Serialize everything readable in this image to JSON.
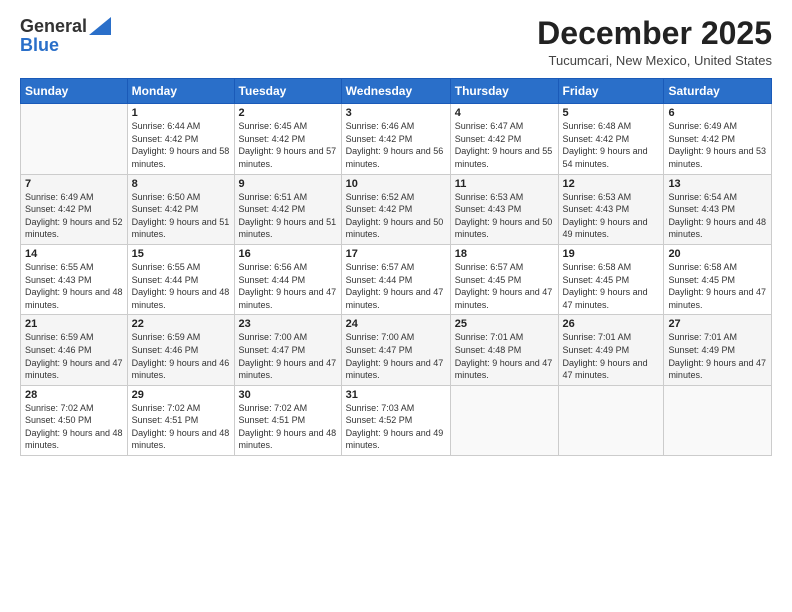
{
  "header": {
    "logo_general": "General",
    "logo_blue": "Blue",
    "month_title": "December 2025",
    "location": "Tucumcari, New Mexico, United States"
  },
  "days_of_week": [
    "Sunday",
    "Monday",
    "Tuesday",
    "Wednesday",
    "Thursday",
    "Friday",
    "Saturday"
  ],
  "weeks": [
    [
      {
        "day": "",
        "sunrise": "",
        "sunset": "",
        "daylight": ""
      },
      {
        "day": "1",
        "sunrise": "Sunrise: 6:44 AM",
        "sunset": "Sunset: 4:42 PM",
        "daylight": "Daylight: 9 hours and 58 minutes."
      },
      {
        "day": "2",
        "sunrise": "Sunrise: 6:45 AM",
        "sunset": "Sunset: 4:42 PM",
        "daylight": "Daylight: 9 hours and 57 minutes."
      },
      {
        "day": "3",
        "sunrise": "Sunrise: 6:46 AM",
        "sunset": "Sunset: 4:42 PM",
        "daylight": "Daylight: 9 hours and 56 minutes."
      },
      {
        "day": "4",
        "sunrise": "Sunrise: 6:47 AM",
        "sunset": "Sunset: 4:42 PM",
        "daylight": "Daylight: 9 hours and 55 minutes."
      },
      {
        "day": "5",
        "sunrise": "Sunrise: 6:48 AM",
        "sunset": "Sunset: 4:42 PM",
        "daylight": "Daylight: 9 hours and 54 minutes."
      },
      {
        "day": "6",
        "sunrise": "Sunrise: 6:49 AM",
        "sunset": "Sunset: 4:42 PM",
        "daylight": "Daylight: 9 hours and 53 minutes."
      }
    ],
    [
      {
        "day": "7",
        "sunrise": "Sunrise: 6:49 AM",
        "sunset": "Sunset: 4:42 PM",
        "daylight": "Daylight: 9 hours and 52 minutes."
      },
      {
        "day": "8",
        "sunrise": "Sunrise: 6:50 AM",
        "sunset": "Sunset: 4:42 PM",
        "daylight": "Daylight: 9 hours and 51 minutes."
      },
      {
        "day": "9",
        "sunrise": "Sunrise: 6:51 AM",
        "sunset": "Sunset: 4:42 PM",
        "daylight": "Daylight: 9 hours and 51 minutes."
      },
      {
        "day": "10",
        "sunrise": "Sunrise: 6:52 AM",
        "sunset": "Sunset: 4:42 PM",
        "daylight": "Daylight: 9 hours and 50 minutes."
      },
      {
        "day": "11",
        "sunrise": "Sunrise: 6:53 AM",
        "sunset": "Sunset: 4:43 PM",
        "daylight": "Daylight: 9 hours and 50 minutes."
      },
      {
        "day": "12",
        "sunrise": "Sunrise: 6:53 AM",
        "sunset": "Sunset: 4:43 PM",
        "daylight": "Daylight: 9 hours and 49 minutes."
      },
      {
        "day": "13",
        "sunrise": "Sunrise: 6:54 AM",
        "sunset": "Sunset: 4:43 PM",
        "daylight": "Daylight: 9 hours and 48 minutes."
      }
    ],
    [
      {
        "day": "14",
        "sunrise": "Sunrise: 6:55 AM",
        "sunset": "Sunset: 4:43 PM",
        "daylight": "Daylight: 9 hours and 48 minutes."
      },
      {
        "day": "15",
        "sunrise": "Sunrise: 6:55 AM",
        "sunset": "Sunset: 4:44 PM",
        "daylight": "Daylight: 9 hours and 48 minutes."
      },
      {
        "day": "16",
        "sunrise": "Sunrise: 6:56 AM",
        "sunset": "Sunset: 4:44 PM",
        "daylight": "Daylight: 9 hours and 47 minutes."
      },
      {
        "day": "17",
        "sunrise": "Sunrise: 6:57 AM",
        "sunset": "Sunset: 4:44 PM",
        "daylight": "Daylight: 9 hours and 47 minutes."
      },
      {
        "day": "18",
        "sunrise": "Sunrise: 6:57 AM",
        "sunset": "Sunset: 4:45 PM",
        "daylight": "Daylight: 9 hours and 47 minutes."
      },
      {
        "day": "19",
        "sunrise": "Sunrise: 6:58 AM",
        "sunset": "Sunset: 4:45 PM",
        "daylight": "Daylight: 9 hours and 47 minutes."
      },
      {
        "day": "20",
        "sunrise": "Sunrise: 6:58 AM",
        "sunset": "Sunset: 4:45 PM",
        "daylight": "Daylight: 9 hours and 47 minutes."
      }
    ],
    [
      {
        "day": "21",
        "sunrise": "Sunrise: 6:59 AM",
        "sunset": "Sunset: 4:46 PM",
        "daylight": "Daylight: 9 hours and 47 minutes."
      },
      {
        "day": "22",
        "sunrise": "Sunrise: 6:59 AM",
        "sunset": "Sunset: 4:46 PM",
        "daylight": "Daylight: 9 hours and 46 minutes."
      },
      {
        "day": "23",
        "sunrise": "Sunrise: 7:00 AM",
        "sunset": "Sunset: 4:47 PM",
        "daylight": "Daylight: 9 hours and 47 minutes."
      },
      {
        "day": "24",
        "sunrise": "Sunrise: 7:00 AM",
        "sunset": "Sunset: 4:47 PM",
        "daylight": "Daylight: 9 hours and 47 minutes."
      },
      {
        "day": "25",
        "sunrise": "Sunrise: 7:01 AM",
        "sunset": "Sunset: 4:48 PM",
        "daylight": "Daylight: 9 hours and 47 minutes."
      },
      {
        "day": "26",
        "sunrise": "Sunrise: 7:01 AM",
        "sunset": "Sunset: 4:49 PM",
        "daylight": "Daylight: 9 hours and 47 minutes."
      },
      {
        "day": "27",
        "sunrise": "Sunrise: 7:01 AM",
        "sunset": "Sunset: 4:49 PM",
        "daylight": "Daylight: 9 hours and 47 minutes."
      }
    ],
    [
      {
        "day": "28",
        "sunrise": "Sunrise: 7:02 AM",
        "sunset": "Sunset: 4:50 PM",
        "daylight": "Daylight: 9 hours and 48 minutes."
      },
      {
        "day": "29",
        "sunrise": "Sunrise: 7:02 AM",
        "sunset": "Sunset: 4:51 PM",
        "daylight": "Daylight: 9 hours and 48 minutes."
      },
      {
        "day": "30",
        "sunrise": "Sunrise: 7:02 AM",
        "sunset": "Sunset: 4:51 PM",
        "daylight": "Daylight: 9 hours and 48 minutes."
      },
      {
        "day": "31",
        "sunrise": "Sunrise: 7:03 AM",
        "sunset": "Sunset: 4:52 PM",
        "daylight": "Daylight: 9 hours and 49 minutes."
      },
      {
        "day": "",
        "sunrise": "",
        "sunset": "",
        "daylight": ""
      },
      {
        "day": "",
        "sunrise": "",
        "sunset": "",
        "daylight": ""
      },
      {
        "day": "",
        "sunrise": "",
        "sunset": "",
        "daylight": ""
      }
    ]
  ]
}
